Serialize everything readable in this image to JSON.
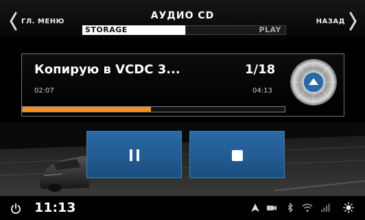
{
  "header": {
    "title": "АУДИО CD",
    "left_nav_label": "ГЛ. МЕНЮ",
    "right_nav_label": "НАЗАД",
    "tabs": [
      {
        "label": "STORAGE",
        "selected": true
      },
      {
        "label": "PLAY",
        "selected": false
      }
    ]
  },
  "player": {
    "track_title": "Копирую в VCDC 3...",
    "track_number": "1/18",
    "elapsed": "02:07",
    "total": "04:13",
    "progress_fraction": 0.49,
    "progress_color": "#f0921e",
    "disc_icon": "eject-disc-icon"
  },
  "controls": {
    "pause_icon": "pause-icon",
    "stop_icon": "stop-icon",
    "button_color": "#2a6aa4"
  },
  "statusbar": {
    "clock": "11:13",
    "icons": [
      "power-icon",
      "navigation-arrow-icon",
      "camera-icon",
      "bluetooth-icon",
      "wifi-icon",
      "cellular-3g-icon",
      "brightness-icon"
    ]
  }
}
